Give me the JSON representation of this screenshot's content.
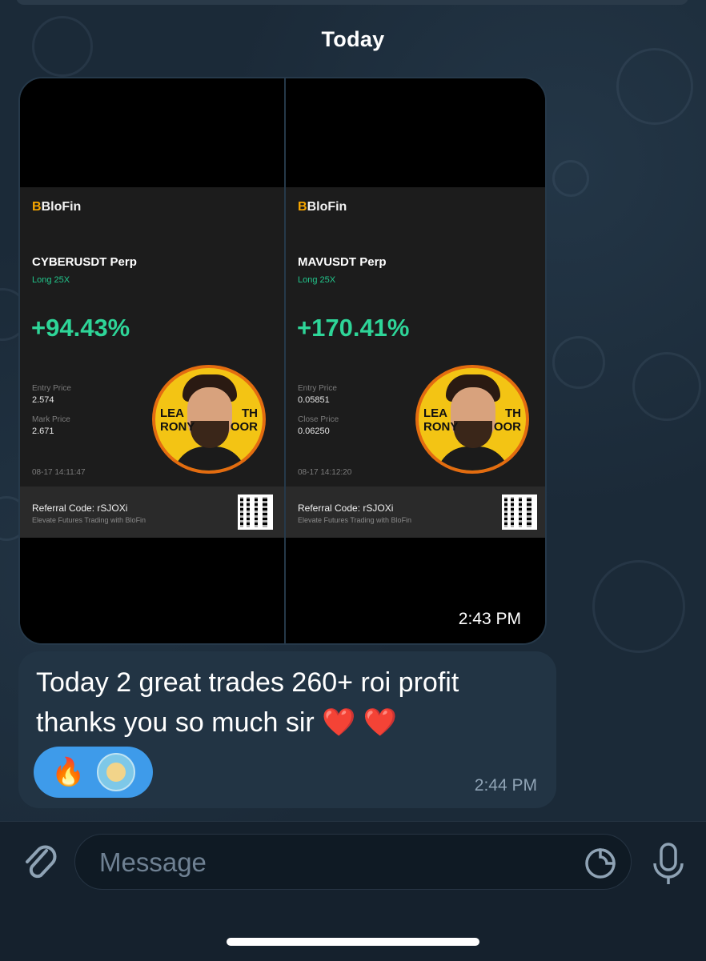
{
  "chat": {
    "date_separator": "Today",
    "photo_message": {
      "time": "2:43 PM",
      "cards": [
        {
          "brand": "BloFin",
          "pair": "CYBERUSDT Perp",
          "leverage": "Long 25X",
          "roi": "+94.43%",
          "price1_label": "Entry Price",
          "price1_value": "2.574",
          "price2_label": "Mark Price",
          "price2_value": "2.671",
          "timestamp": "08-17 14:11:47",
          "referral": "Referral Code: rSJOXi",
          "tagline": "Elevate Futures Trading with BloFin",
          "avatar_text_left": "LEA\nRONY",
          "avatar_text_right": "TH\nOOR"
        },
        {
          "brand": "BloFin",
          "pair": "MAVUSDT Perp",
          "leverage": "Long 25X",
          "roi": "+170.41%",
          "price1_label": "Entry Price",
          "price1_value": "0.05851",
          "price2_label": "Close Price",
          "price2_value": "0.06250",
          "timestamp": "08-17 14:12:20",
          "referral": "Referral Code: rSJOXi",
          "tagline": "Elevate Futures Trading with BloFin",
          "avatar_text_left": "LEA\nRONY",
          "avatar_text_right": "TH\nOOR"
        }
      ]
    },
    "text_message": {
      "line1": "Today 2 great trades 260+ roi profit",
      "line2": "thanks you so much sir",
      "hearts": "❤️ ❤️",
      "time": "2:44 PM",
      "reactions": [
        {
          "icon": "fire-emoji",
          "glyph": "🔥"
        },
        {
          "icon": "cat-sticker"
        }
      ]
    }
  },
  "composer": {
    "placeholder": "Message",
    "attach_icon": "paperclip-icon",
    "sticker_icon": "sticker-icon",
    "mic_icon": "microphone-icon"
  },
  "colors": {
    "chat_background": "#1b2a38",
    "bubble": "#223444",
    "reaction_pill": "#3e9bea",
    "profit_green": "#2ed598",
    "brand_accent": "#f7a600"
  }
}
